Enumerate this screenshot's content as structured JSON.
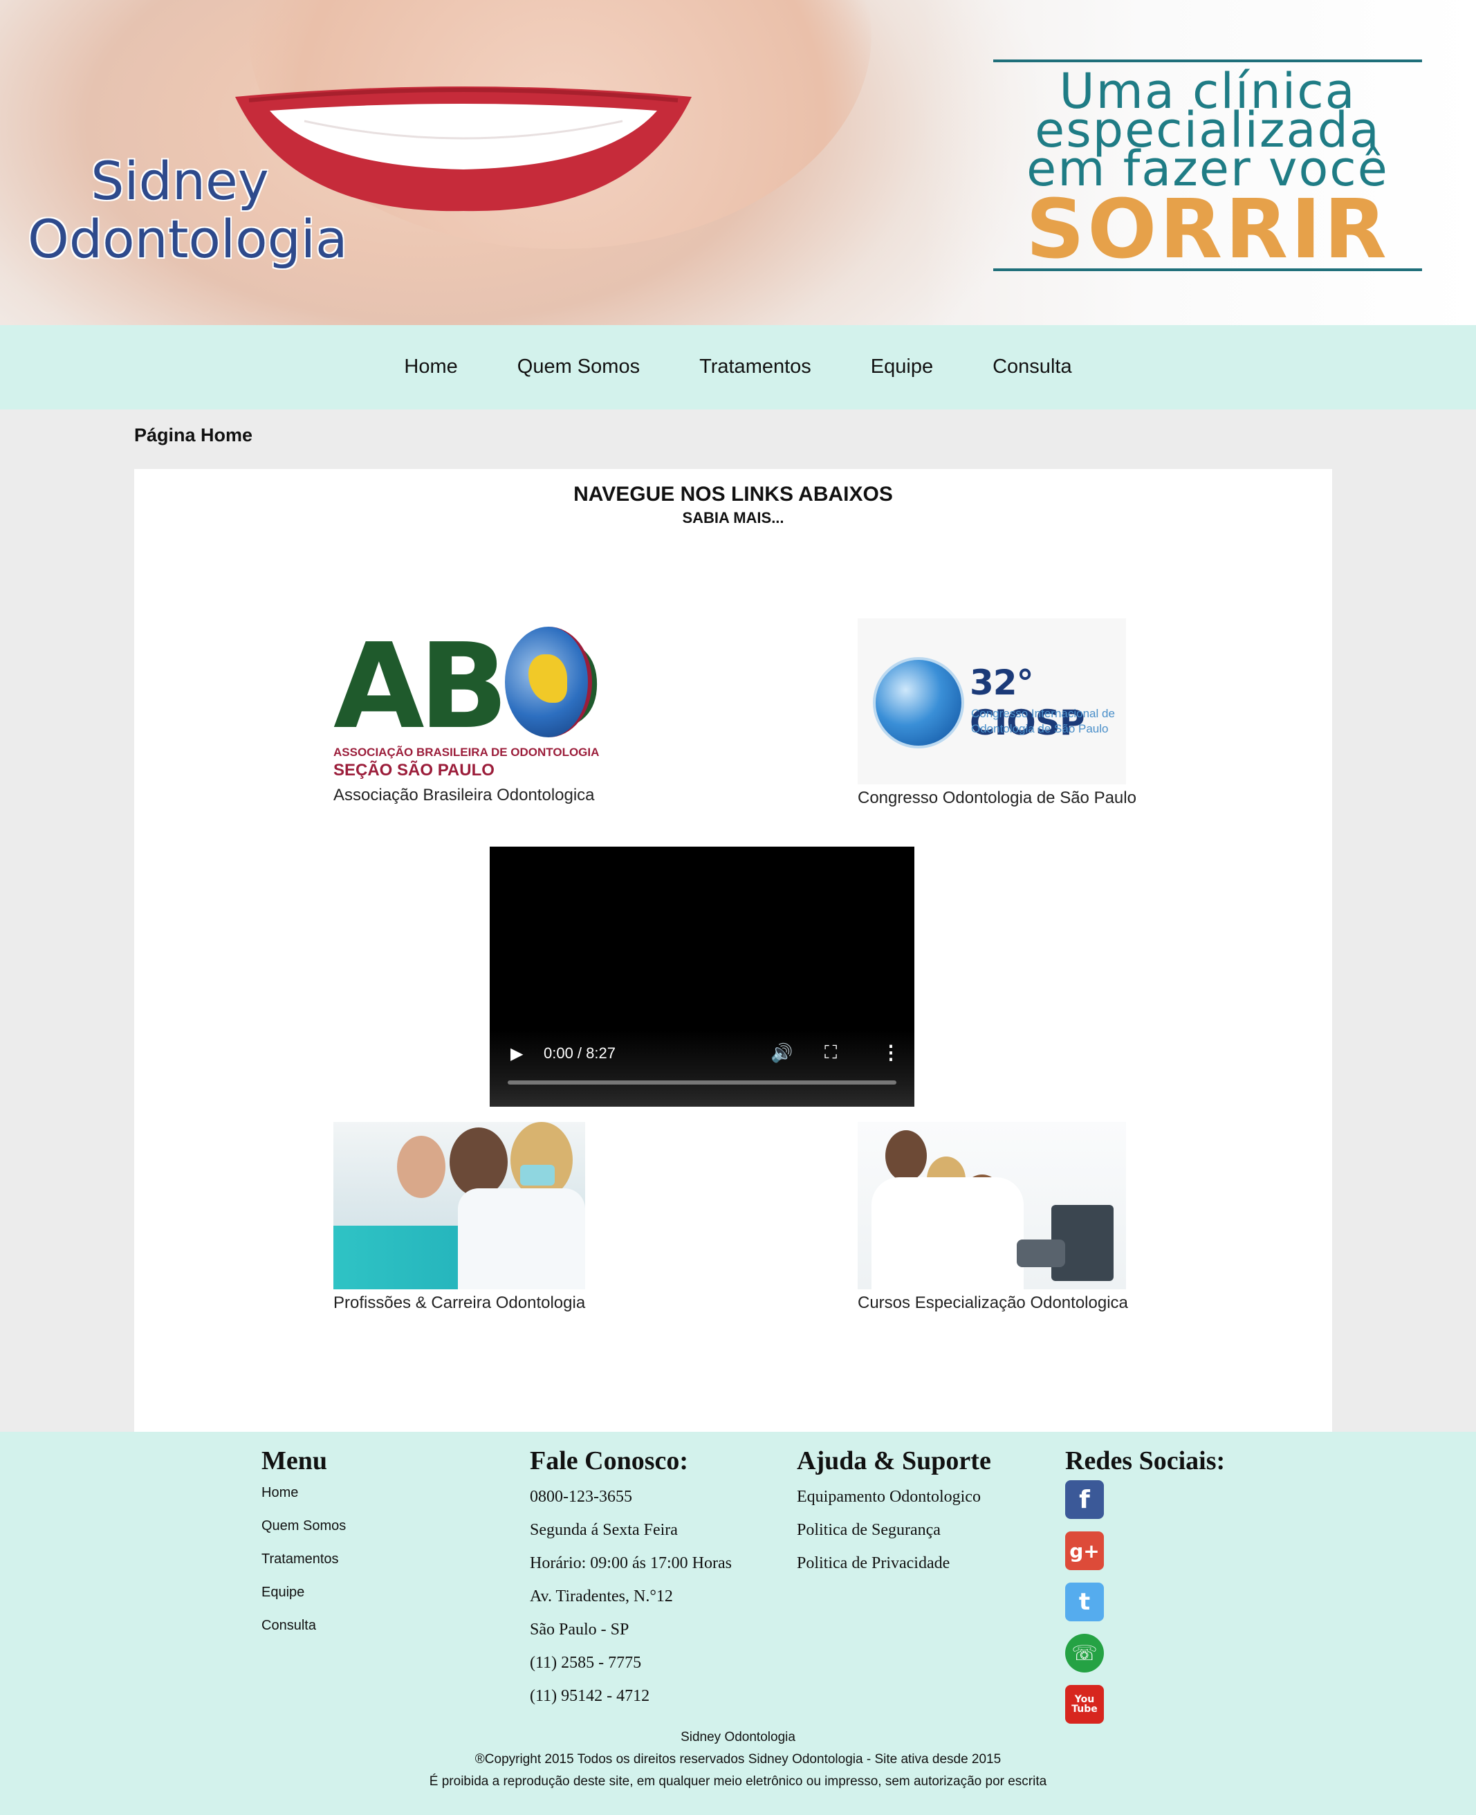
{
  "header": {
    "brand_line1": "Sidney",
    "brand_line2": "Odontologia",
    "slogan_line1": "Uma clínica",
    "slogan_line2": "especializada",
    "slogan_line3": "em fazer você",
    "slogan_big": "SORRIR"
  },
  "nav": {
    "items": [
      "Home",
      "Quem Somos",
      "Tratamentos",
      "Equipe",
      "Consulta"
    ]
  },
  "breadcrumb": "Página Home",
  "content": {
    "heading": "NAVEGUE NOS LINKS ABAIXOS",
    "subheading": "SABIA MAIS...",
    "cards": [
      {
        "caption": "Associação Brasileira Odontologica",
        "logo_text": "ABO",
        "logo_sub1": "ASSOCIAÇÃO BRASILEIRA DE ODONTOLOGIA",
        "logo_sub2": "SEÇÃO SÃO PAULO"
      },
      {
        "caption": "Congresso Odontologia de São Paulo",
        "logo_text": "32° CIOSP",
        "logo_sub1": "Congresso Internacional de",
        "logo_sub2": "Odontologia de São Paulo"
      },
      {
        "caption": "Profissões & Carreira Odontologia"
      },
      {
        "caption": "Cursos Especialização Odontologica"
      }
    ],
    "video": {
      "time": "0:00 / 8:27",
      "progress": 0
    }
  },
  "footer": {
    "menu_title": "Menu",
    "menu_items": [
      "Home",
      "Quem Somos",
      "Tratamentos",
      "Equipe",
      "Consulta"
    ],
    "contact_title": "Fale Conosco:",
    "contact_lines": [
      "0800-123-3655",
      "Segunda á Sexta Feira",
      "Horário: 09:00 ás 17:00 Horas",
      "Av. Tiradentes, N.°12",
      "São Paulo - SP",
      "(11) 2585 - 7775",
      "(11) 95142 - 4712"
    ],
    "help_title": "Ajuda & Suporte",
    "help_items": [
      "Equipamento Odontologico",
      "Politica de Segurança",
      "Politica de Privacidade"
    ],
    "social_title": "Redes Sociais:",
    "social": [
      {
        "name": "facebook-icon",
        "glyph": "f",
        "color": "#3b5998"
      },
      {
        "name": "google-plus-icon",
        "glyph": "g+",
        "color": "#dd4b39"
      },
      {
        "name": "twitter-icon",
        "glyph": "t",
        "color": "#55acee"
      },
      {
        "name": "whatsapp-icon",
        "glyph": "☏",
        "color": "#25a244"
      },
      {
        "name": "youtube-icon",
        "glyph": "You Tube",
        "color": "#d7261e"
      }
    ],
    "copyright1": "Sidney Odontologia",
    "copyright2": "®Copyright 2015 Todos os direitos reservados Sidney Odontologia - Site ativa desde 2015",
    "copyright3": "É proibida a reprodução deste site, em qualquer meio eletrônico ou impresso, sem autorização por escrita"
  }
}
